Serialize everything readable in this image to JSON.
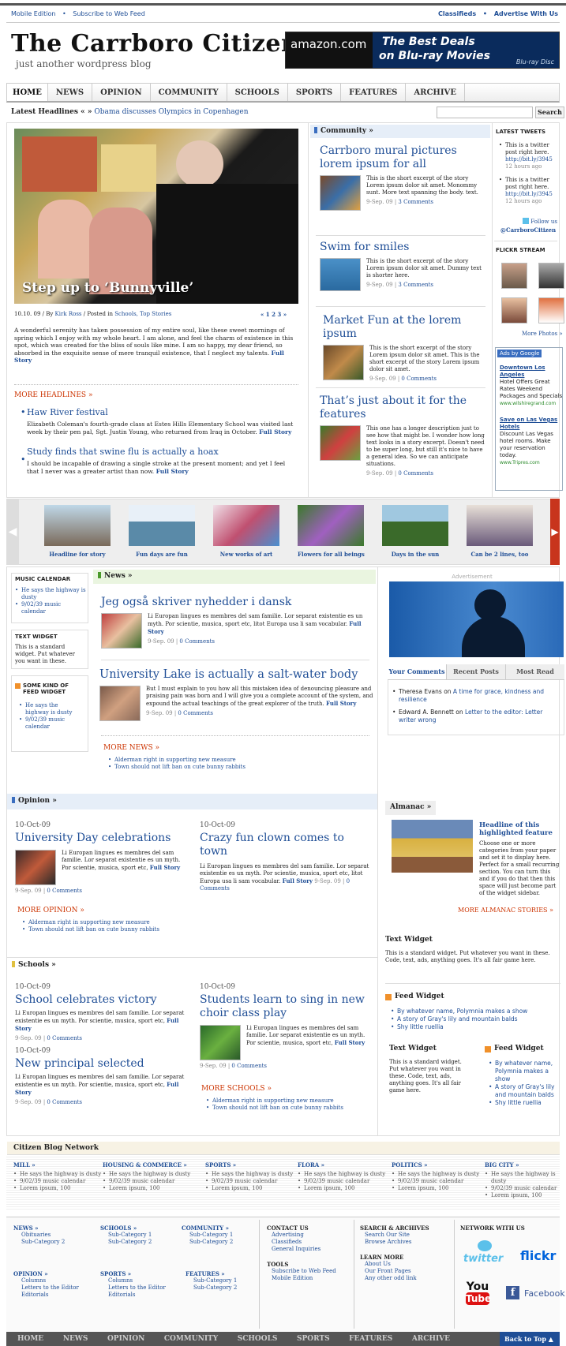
{
  "top": {
    "mobile": "Mobile Edition",
    "subscribe": "Subscribe to Web Feed",
    "classifieds": "Classifieds",
    "advertise": "Advertise With Us"
  },
  "site": {
    "title": "The Carrboro Citizen",
    "tagline": "just another wordpress blog"
  },
  "ad": {
    "brand": "amazon.com",
    "text1": "The Best Deals",
    "text2": "on Blu-ray Movies",
    "logo": "Blu-ray Disc"
  },
  "nav": [
    "HOME",
    "NEWS",
    "OPINION",
    "COMMUNITY",
    "SCHOOLS",
    "SPORTS",
    "FEATURES",
    "ARCHIVE"
  ],
  "latest": {
    "label": "Latest Headlines « »",
    "link": "Obama discusses Olympics in Copenhagen"
  },
  "search": {
    "button": "Search",
    "placeholder": ""
  },
  "featured": {
    "caption": "Step up to ‘Bunnyville’",
    "meta_date": "10.10. 09 / By",
    "meta_author": "Kirk Ross",
    "meta_posted": "/ Posted in",
    "meta_cats": "Schools, Top Stories",
    "pager": "« 1 2 3 »",
    "text": "A wonderful serenity has taken possession of my entire soul, like these sweet mornings of spring which I enjoy with my whole heart. I am alone, and feel the charm of existence in this spot, which was created for the bliss of souls like mine. I am so happy, my dear friend, so absorbed in the exquisite sense of mere tranquil existence, that I neglect my talents.",
    "full": "Full Story"
  },
  "more_headlines": {
    "label": "MORE HEADLINES »",
    "items": [
      {
        "title": "Haw River festival",
        "text": "Elizabeth Coleman's fourth-grade class at Estes Hills Elementary School was visited last week by their pen pal, Sgt. Justin Young, who returned from Iraq in October.",
        "full": "Full Story"
      },
      {
        "title": "Study finds that swine flu is actually a hoax",
        "text": "I should be incapable of drawing a single stroke at the present moment; and yet I feel that I never was a greater artist than now.",
        "full": "Full Story"
      }
    ]
  },
  "community": {
    "label": "Community »",
    "posts": [
      {
        "title": "Carrboro mural pictures lorem ipsum for all",
        "text": "This is the short excerpt of the story Lorem ipsum dolor sit amet. Monommy sunt. More text spanning the body. text.",
        "date": "9-Sep. 09 |",
        "comments": "3 Comments"
      },
      {
        "title": "Swim for smiles",
        "text": "This is the short excerpt of the story Lorem ipsum dolor sit amet. Dummy text is shorter here.",
        "date": "9-Sep. 09 |",
        "comments": "3 Comments"
      },
      {
        "title": "Market Fun at the lorem ipsum",
        "text": "This is the short excerpt of the story Lorem ipsum dolor sit amet. This is the short excerpt of the story Lorem ipsum dolor sit amet.",
        "date": "9-Sep. 09 |",
        "comments": "0 Comments"
      },
      {
        "title": "That’s just about it for the features",
        "text": "This one has a longer description just to see how that might be. I wonder how long text looks in a story excerpt. Doesn't need to be super long, but still it's nice to have a general idea. So we can anticipate situations.",
        "date": "9-Sep. 09 |",
        "comments": "0 Comments"
      }
    ]
  },
  "tweets": {
    "label": "LATEST TWEETS",
    "items": [
      {
        "text": "This is a twitter post right here.",
        "link": "http://bit.ly/3945",
        "ago": "12 hours ago"
      },
      {
        "text": "This is a twitter post right here.",
        "link": "http://bit.ly/3945",
        "ago": "12 hours ago"
      }
    ],
    "follow": "Follow us",
    "handle": "@CarrboroCitizen"
  },
  "flickr": {
    "label": "FLICKR STREAM",
    "more": "More Photos »"
  },
  "google_ads": {
    "label": "Ads by Google",
    "ads": [
      {
        "title": "Downtown Los Angeles",
        "text": "Hotel Offers Great Rates Weekend Packages and Specials",
        "url": "www.wilshiregrand.com"
      },
      {
        "title": "Save on Las Vegas Hotels",
        "text": "Discount Las Vegas hotel rooms. Make your reservation today.",
        "url": "www.Tripres.com"
      }
    ]
  },
  "carousel": [
    "Headline for story",
    "Fun days are fun",
    "New works of art",
    "Flowers for all beings",
    "Days in the sun",
    "Can be 2 lines, too"
  ],
  "music": {
    "label": "MUSIC CALENDAR",
    "items": [
      "He says the highway is dusty",
      "9/02/39 music calendar"
    ]
  },
  "text_widget": {
    "label": "TEXT WIDGET",
    "text": "This is a standard widget. Put whatever you want in these."
  },
  "feed_widget": {
    "label": "SOME KIND OF FEED WIDGET",
    "items": [
      "He says the highway is dusty",
      "9/02/39 music calendar"
    ]
  },
  "news": {
    "label": "News »",
    "posts": [
      {
        "title": "Jeg også skriver nyhedder i dansk",
        "text": "Li Europan lingues es membres del sam familie. Lor separat existentie es un myth. Por scientie, musica, sport etc, litot Europa usa li sam vocabular.",
        "full": "Full Story",
        "date": "9-Sep. 09 |",
        "comments": "0 Comments"
      },
      {
        "title": "University Lake is actually a salt-water body",
        "text": "But I must explain to you how all this mistaken idea of denouncing pleasure and praising pain was born and I will give you a complete account of the system, and expound the actual teachings of the great explorer of the truth.",
        "full": "Full Story",
        "date": "9-Sep. 09 |",
        "comments": "0 Comments"
      }
    ],
    "more": "MORE NEWS »",
    "more_items": [
      "Alderman right in supporting new measure",
      "Town should not lift ban on cute bunny rabbits"
    ]
  },
  "advert": {
    "label": "Advertisement"
  },
  "tabs": [
    "Your Comments",
    "Recent Posts",
    "Most Read"
  ],
  "comments": [
    {
      "who": "Theresa Evans on",
      "link": "A time for grace, kindness and resilience"
    },
    {
      "who": "Edward A. Bennett on",
      "link": "Letter to the editor: Letter writer wrong"
    }
  ],
  "opinion": {
    "label": "Opinion »",
    "posts": [
      {
        "date": "10-Oct-09",
        "title": "University Day celebrations",
        "text": "Li Europan lingues es membres del sam familie. Lor separat existentie es un myth. Por scientie, musica, sport etc,",
        "full": "Full Story",
        "meta_date": "9-Sep. 09 |",
        "comments": "0 Comments"
      },
      {
        "date": "10-Oct-09",
        "title": "Crazy fun clown comes to town",
        "text": "Li Europan lingues es membres del sam familie. Lor separat existentie es un myth. Por scientie, musica, sport etc, litot Europa usa li sam vocabular.",
        "full": "Full Story",
        "meta_date": "9-Sep. 09 |",
        "comments": "0 Comments"
      }
    ],
    "more": "MORE OPINION »",
    "more_items": [
      "Alderman right in supporting new measure",
      "Town should not lift ban on cute bunny rabbits"
    ]
  },
  "almanac": {
    "label": "Almanac »",
    "title": "Headline of this highlighted feature",
    "text": "Choose one or more categories from your paper and set it to display here. Perfect for a small recurring section. You can turn this and if you do that then this space will just become part of the widget sidebar.",
    "more": "MORE ALMANAC STORIES »"
  },
  "schools": {
    "label": "Schools »",
    "posts": [
      {
        "date": "10-Oct-09",
        "title": "School celebrates victory",
        "text": "Li Europan lingues es membres del sam familie. Lor separat existentie es un myth. Por scientie, musica, sport etc,",
        "full": "Full Story",
        "meta_date": "9-Sep. 09 |",
        "comments": "0 Comments"
      },
      {
        "date": "10-Oct-09",
        "title": "New principal selected",
        "text": "Li Europan lingues es membres del sam familie. Lor separat existentie es un myth. Por scientie, musica, sport etc,",
        "full": "Full Story",
        "meta_date": "9-Sep. 09 |",
        "comments": "0 Comments"
      },
      {
        "date": "10-Oct-09",
        "title": "Students learn to sing in new choir class play",
        "text": "Li Europan lingues es membres del sam familie. Lor separat existentie es un myth. Por scientie, musica, sport etc,",
        "full": "Full Story",
        "meta_date": "9-Sep. 09 |",
        "comments": "0 Comments"
      }
    ],
    "more": "MORE SCHOOLS »",
    "more_items": [
      "Alderman right in supporting new measure",
      "Town should not lift ban on cute bunny rabbits"
    ]
  },
  "side_text_widget": {
    "label": "Text Widget",
    "text": "This is a standard widget. Put whatever you want in these. Code, text, ads, anything goes. It's all fair game here."
  },
  "side_feed_widget": {
    "label": "Feed Widget",
    "items": [
      "By whatever name, Polymnia makes a show",
      "A story of Gray's lily and mountain balds",
      "Shy little ruellia"
    ]
  },
  "side_text_widget2": {
    "label": "Text Widget",
    "text": "This is a standard widget. Put whatever you want in these. Code, text, ads, anything goes. It's all fair game here."
  },
  "side_feed_widget2": {
    "label": "Feed Widget",
    "items": [
      "By whatever name, Polymnia makes a show",
      "A story of Gray's lily and mountain balds",
      "Shy little ruellia"
    ]
  },
  "blognet": {
    "label": "Citizen Blog Network",
    "cols": [
      {
        "head": "MILL »",
        "items": [
          "He says the highway is dusty",
          "9/02/39 music calendar",
          "Lorem ipsum, 100"
        ]
      },
      {
        "head": "HOUSING & COMMERCE »",
        "items": [
          "He says the highway is dusty",
          "9/02/39 music calendar",
          "Lorem ipsum, 100"
        ]
      },
      {
        "head": "SPORTS »",
        "items": [
          "He says the highway is dusty",
          "9/02/39 music calendar",
          "Lorem ipsum, 100"
        ]
      },
      {
        "head": "FLORA »",
        "items": [
          "He says the highway is dusty",
          "9/02/39 music calendar",
          "Lorem ipsum, 100"
        ]
      },
      {
        "head": "POLITICS »",
        "items": [
          "He says the highway is dusty",
          "9/02/39 music calendar",
          "Lorem ipsum, 100"
        ]
      },
      {
        "head": "BIG CITY »",
        "items": [
          "He says the highway is dusty",
          "9/02/39 music calendar",
          "Lorem ipsum, 100"
        ]
      }
    ]
  },
  "footer": {
    "news": {
      "head": "NEWS »",
      "items": [
        "Obituaries",
        "Sub-Category 2"
      ]
    },
    "schools": {
      "head": "SCHOOLS »",
      "items": [
        "Sub-Category 1",
        "Sub-Category 2"
      ]
    },
    "community": {
      "head": "COMMUNITY »",
      "items": [
        "Sub-Category 1",
        "Sub-Category 2"
      ]
    },
    "opinion": {
      "head": "OPINION »",
      "items": [
        "Columns",
        "Letters to the Editor",
        "Editorials"
      ]
    },
    "sports": {
      "head": "SPORTS »",
      "items": [
        "Columns",
        "Letters to the Editor",
        "Editorials"
      ]
    },
    "features": {
      "head": "FEATURES »",
      "items": [
        "Sub-Category 1",
        "Sub-Category 2"
      ]
    },
    "contact": {
      "head": "CONTACT US",
      "items": [
        "Advertising",
        "Classifieds",
        "General Inquiries"
      ]
    },
    "tools": {
      "head": "TOOLS",
      "items": [
        "Subscribe to Web Feed",
        "Mobile Edition"
      ]
    },
    "search": {
      "head": "SEARCH & ARCHIVES",
      "items": [
        "Search Our Site",
        "Browse Archives"
      ]
    },
    "learn": {
      "head": "LEARN MORE",
      "items": [
        "About Us",
        "Our Front Pages",
        "Any other odd link"
      ]
    },
    "network": {
      "head": "NETWORK WITH US",
      "twitter": "twitter",
      "flickr": "flickr",
      "youtube_you": "You",
      "youtube_tube": "Tube",
      "facebook": "Facebook"
    }
  },
  "bottom_nav": [
    "HOME",
    "NEWS",
    "OPINION",
    "COMMUNITY",
    "SCHOOLS",
    "SPORTS",
    "FEATURES",
    "ARCHIVE"
  ],
  "back_to_top": "Back to Top"
}
